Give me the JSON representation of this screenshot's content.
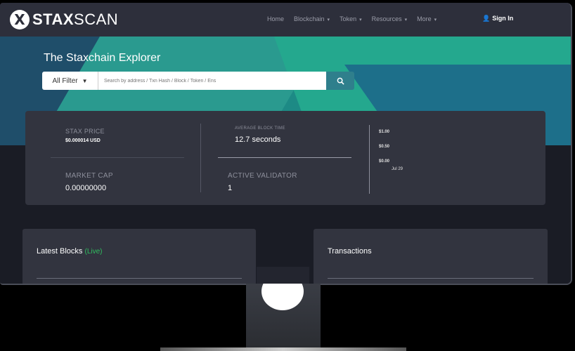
{
  "brand": {
    "mark": "X",
    "name_bold": "STAX",
    "name_rest": "SCAN"
  },
  "nav": {
    "links": [
      {
        "label": "Home",
        "dropdown": false
      },
      {
        "label": "Blockchain",
        "dropdown": true
      },
      {
        "label": "Token",
        "dropdown": true
      },
      {
        "label": "Resources",
        "dropdown": true
      },
      {
        "label": "More",
        "dropdown": true
      }
    ],
    "signin": "Sign In"
  },
  "hero": {
    "title": "The Staxchain Explorer",
    "filter_label": "All Filter",
    "search_placeholder": "Search by address / Txn Hash / Block / Token / Ens",
    "search_icon": "search-icon"
  },
  "stats": {
    "price_label": "STAX PRICE",
    "price_value": "$0.000014 USD",
    "market_cap_label": "MARKET CAP",
    "market_cap_value": "0.00000000",
    "block_time_label": "AVERAGE BLOCK TIME",
    "block_time_value": "12.7 seconds",
    "validator_label": "ACTIVE VALIDATOR",
    "validator_value": "1",
    "chart_ticks": [
      "$1.00",
      "$0.50",
      "$0.00"
    ],
    "chart_date": "Jul 29"
  },
  "panels": {
    "blocks_title": "Latest Blocks",
    "blocks_live": "(Live)",
    "tx_title": "Transactions"
  },
  "colors": {
    "nav_bg": "#2d2f3b",
    "card_bg": "#32343f",
    "accent": "#2f7f8c",
    "live": "#2fbf5f"
  }
}
